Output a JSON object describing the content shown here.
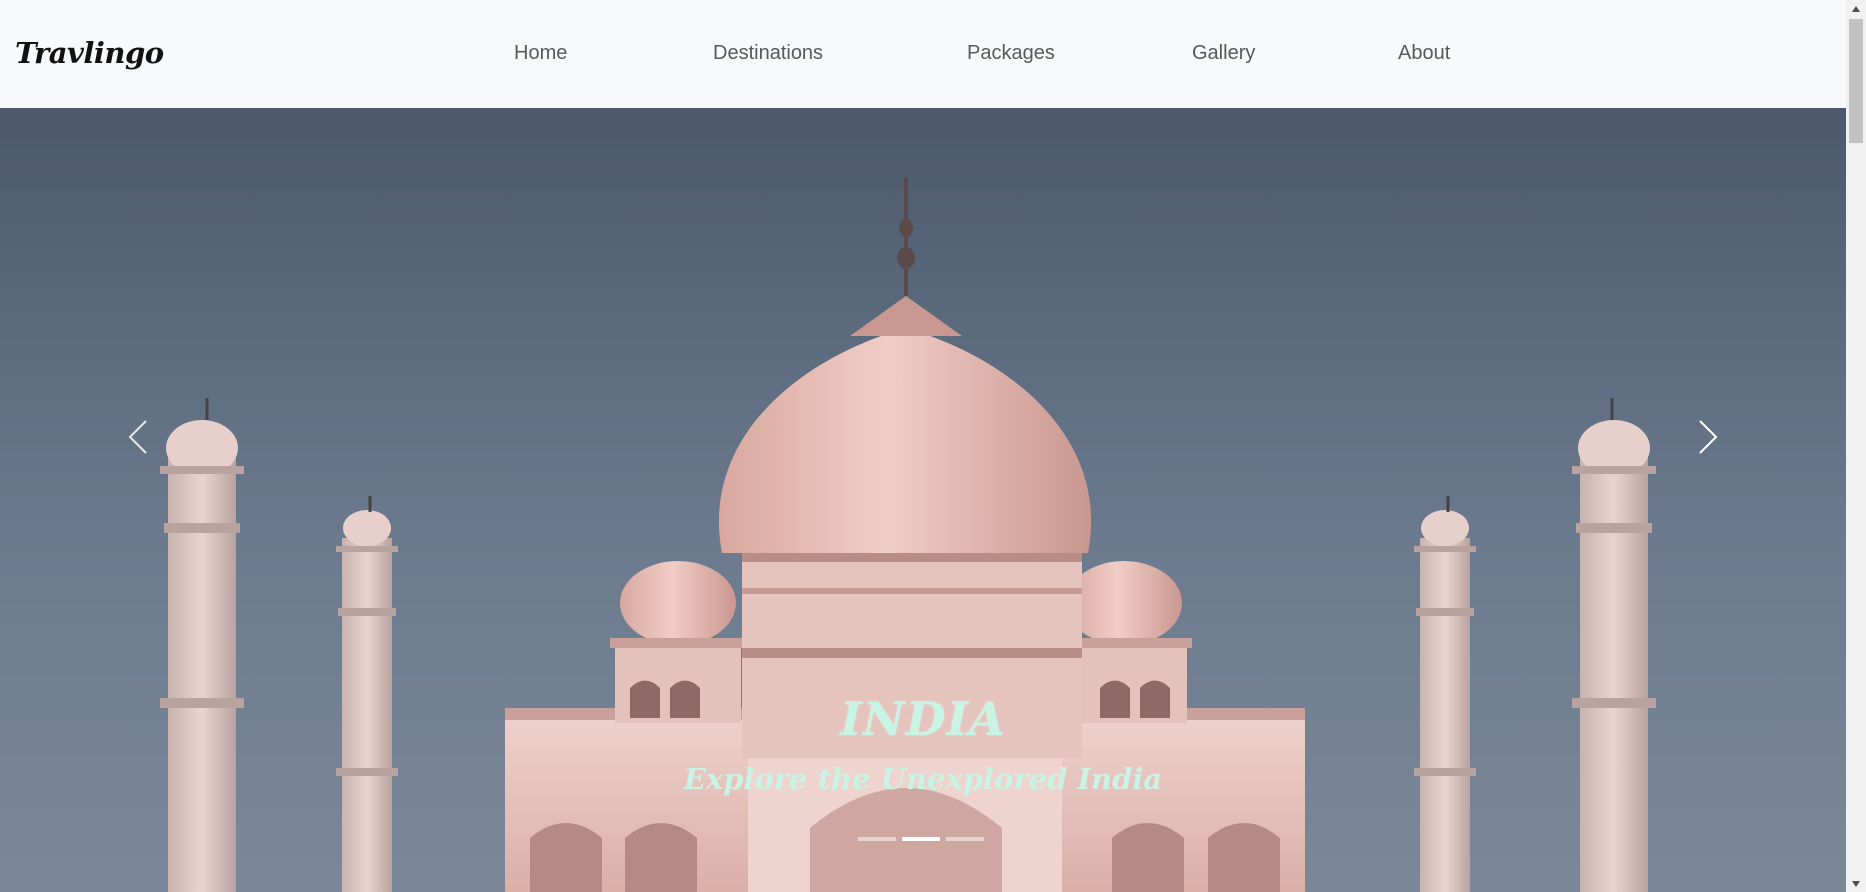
{
  "navbar": {
    "brand": "Travlingo",
    "links": [
      {
        "label": "Home"
      },
      {
        "label": "Destinations"
      },
      {
        "label": "Packages"
      },
      {
        "label": "Gallery"
      },
      {
        "label": "About"
      }
    ]
  },
  "carousel": {
    "title": "INDIA",
    "subtitle": "Explore the Unexplored India",
    "prev_icon": "chevron-left-icon",
    "next_icon": "chevron-right-icon",
    "indicator_count": 3,
    "active_indicator": 2,
    "colors": {
      "caption": "#c9f3e4",
      "sky": "#5a687c",
      "marble": "#e9c9c3"
    }
  },
  "scrollbar": {
    "up_icon": "triangle-up-icon",
    "down_icon": "triangle-down-icon"
  }
}
